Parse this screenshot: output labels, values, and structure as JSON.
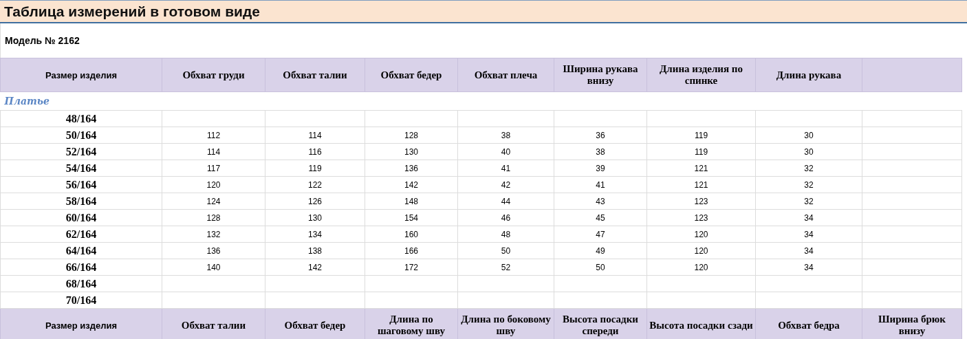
{
  "title": "Таблица измерений в готовом виде",
  "model": "Модель № 2162",
  "header_columns": [
    "Размер изделия",
    "Обхват груди",
    "Обхват талии",
    "Обхват бедер",
    "Обхват плеча",
    "Ширина рукава внизу",
    "Длина изделия по спинке",
    "Длина рукава"
  ],
  "section": "Платье",
  "rows": [
    {
      "size": "48/164"
    },
    {
      "size": "50/164",
      "values": [
        "112",
        "114",
        "128",
        "38",
        "36",
        "119",
        "30"
      ]
    },
    {
      "size": "52/164",
      "values": [
        "114",
        "116",
        "130",
        "40",
        "38",
        "119",
        "30"
      ]
    },
    {
      "size": "54/164",
      "values": [
        "117",
        "119",
        "136",
        "41",
        "39",
        "121",
        "32"
      ]
    },
    {
      "size": "56/164",
      "values": [
        "120",
        "122",
        "142",
        "42",
        "41",
        "121",
        "32"
      ]
    },
    {
      "size": "58/164",
      "values": [
        "124",
        "126",
        "148",
        "44",
        "43",
        "123",
        "32"
      ]
    },
    {
      "size": "60/164",
      "values": [
        "128",
        "130",
        "154",
        "46",
        "45",
        "123",
        "34"
      ]
    },
    {
      "size": "62/164",
      "values": [
        "132",
        "134",
        "160",
        "48",
        "47",
        "120",
        "34"
      ]
    },
    {
      "size": "64/164",
      "values": [
        "136",
        "138",
        "166",
        "50",
        "49",
        "120",
        "34"
      ]
    },
    {
      "size": "66/164",
      "values": [
        "140",
        "142",
        "172",
        "52",
        "50",
        "120",
        "34"
      ]
    },
    {
      "size": "68/164"
    },
    {
      "size": "70/164"
    }
  ],
  "footer_columns": [
    "Размер изделия",
    "Обхват талии",
    "Обхват бедер",
    "Длина по шаговому шву",
    "Длина по боковому шву",
    "Высота посадки спереди",
    "Высота посадки сзади",
    "Обхват бедра",
    "Ширина брюк внизу"
  ]
}
